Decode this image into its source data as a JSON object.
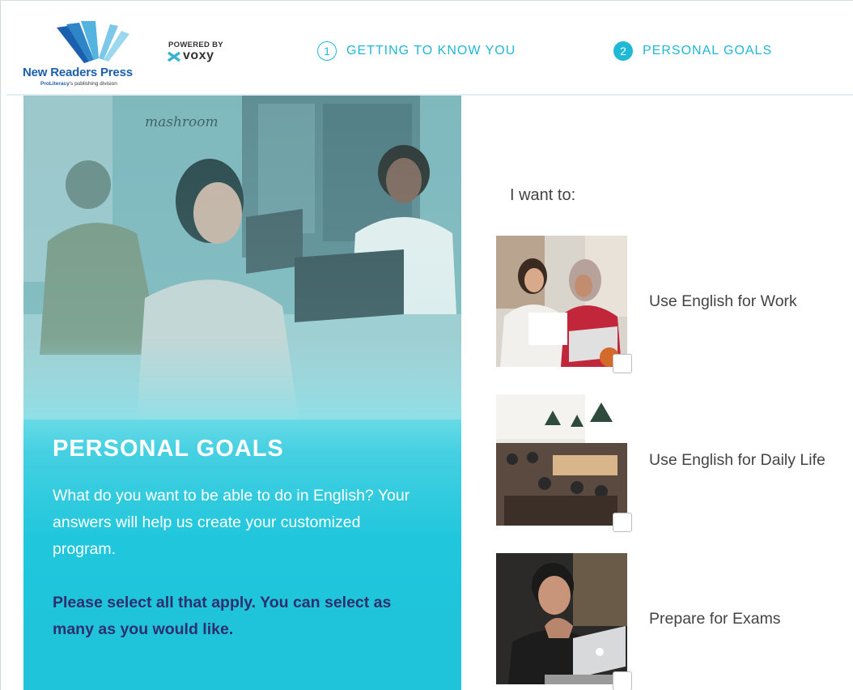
{
  "header": {
    "logo": {
      "brand": "New Readers Press",
      "subtitle_bold": "ProLiteracy",
      "subtitle_rest": "'s publishing division"
    },
    "powered": {
      "label": "POWERED BY",
      "name": "voxy"
    },
    "steps": [
      {
        "number": "1",
        "label": "GETTING TO KNOW YOU"
      },
      {
        "number": "2",
        "label": "PERSONAL GOALS"
      }
    ]
  },
  "left_panel": {
    "title": "PERSONAL GOALS",
    "description": "What do you want to be able to do in English? Your answers will help us create your customized program.",
    "instruction": "Please select all that apply. You can select as many as you would like.",
    "photo_sign": "mashroom"
  },
  "goals": {
    "prompt": "I want to:",
    "options": [
      {
        "label": "Use English for Work",
        "checked": false
      },
      {
        "label": "Use English for Daily Life",
        "checked": false
      },
      {
        "label": "Prepare for Exams",
        "checked": false
      }
    ]
  },
  "colors": {
    "accent": "#1fb8d6",
    "brand_blue": "#1b5fae",
    "panel_cyan": "#1fc3da",
    "instruction_text": "#2d2f6e"
  }
}
